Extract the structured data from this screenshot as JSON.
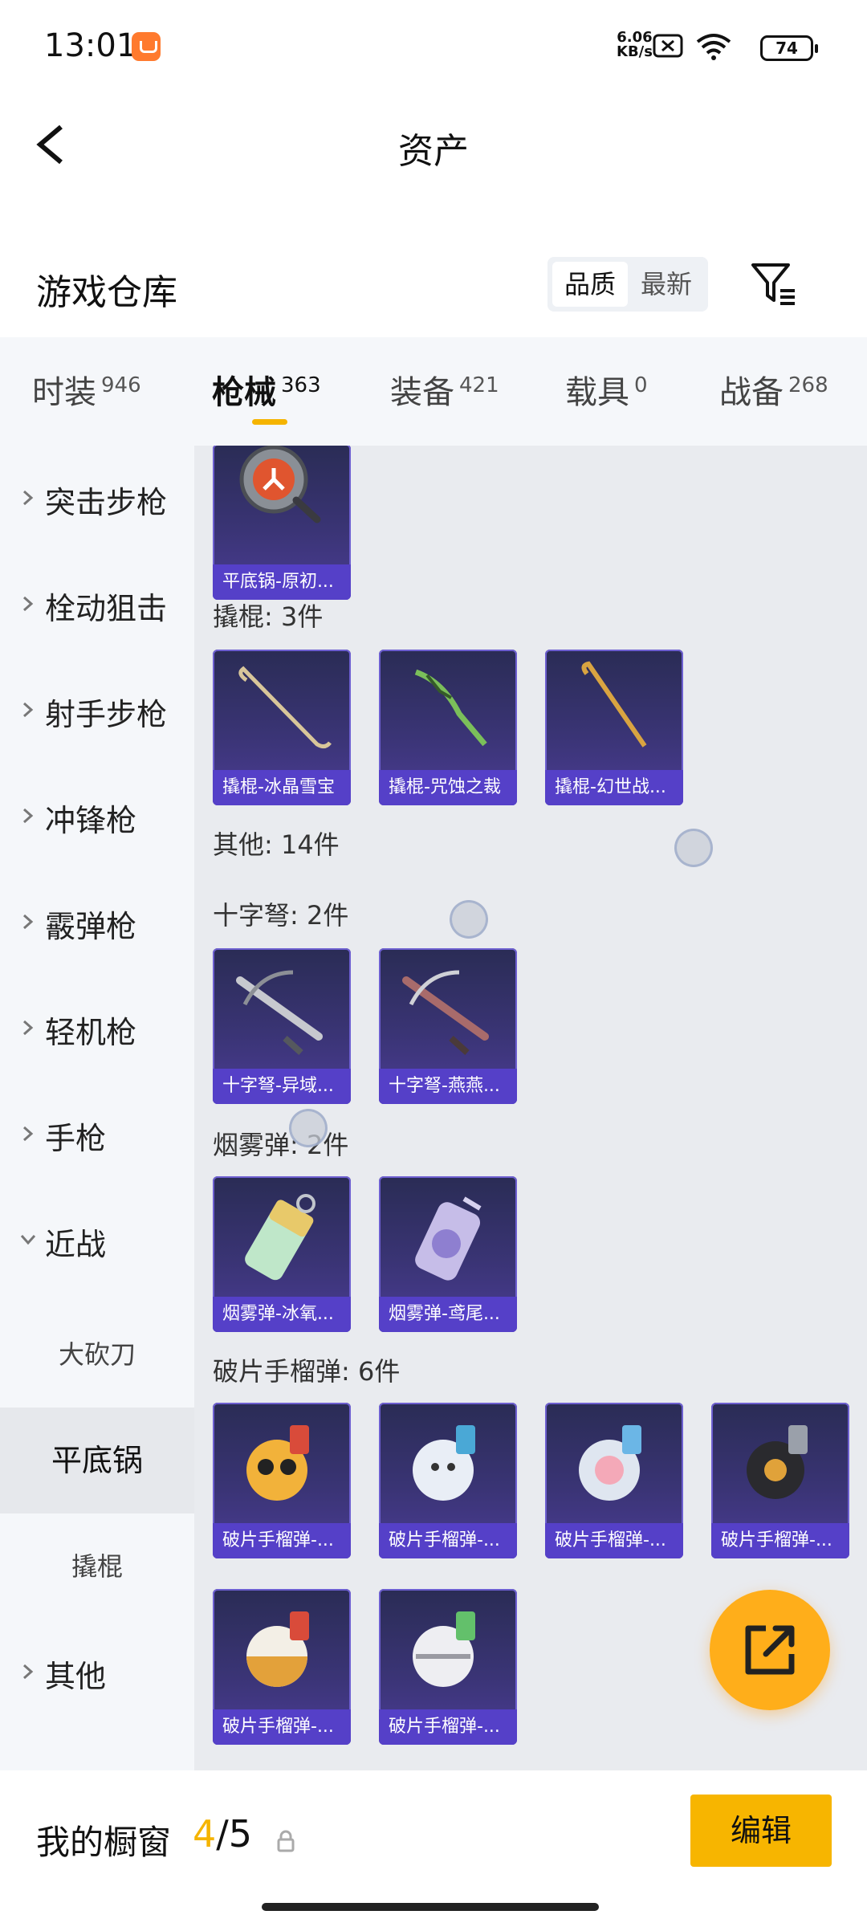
{
  "status_bar": {
    "time": "13:01",
    "net_speed_value": "6.06",
    "net_speed_unit": "KB/s",
    "battery": "74",
    "icons": [
      "app-notification-icon",
      "sim-disabled-icon",
      "wifi-icon",
      "battery-icon"
    ]
  },
  "header": {
    "title": "资产",
    "back_icon": "chevron-left-icon"
  },
  "warehouse": {
    "title": "游戏仓库",
    "sort_options": [
      "品质",
      "最新"
    ],
    "sort_selected": "品质",
    "filter_icon": "filter-icon"
  },
  "tabs": [
    {
      "label": "时装",
      "count": "946"
    },
    {
      "label": "枪械",
      "count": "363",
      "active": true
    },
    {
      "label": "装备",
      "count": "421"
    },
    {
      "label": "载具",
      "count": "0"
    },
    {
      "label": "战备",
      "count": "268"
    }
  ],
  "sidebar": {
    "categories": [
      {
        "label": "突击步枪",
        "expanded": false
      },
      {
        "label": "栓动狙击",
        "expanded": false
      },
      {
        "label": "射手步枪",
        "expanded": false
      },
      {
        "label": "冲锋枪",
        "expanded": false
      },
      {
        "label": "霰弹枪",
        "expanded": false
      },
      {
        "label": "轻机枪",
        "expanded": false
      },
      {
        "label": "手枪",
        "expanded": false
      },
      {
        "label": "近战",
        "expanded": true
      },
      {
        "label": "其他",
        "expanded": false
      }
    ],
    "subitems": [
      {
        "label": "大砍刀"
      },
      {
        "label": "平底锅",
        "selected": true
      },
      {
        "label": "撬棍"
      }
    ]
  },
  "content": {
    "groups": [
      {
        "title": "",
        "items": [
          {
            "caption": "平底锅-原初..."
          }
        ]
      },
      {
        "title": "撬棍: 3件",
        "items": [
          {
            "caption": "撬棍-冰晶雪宝"
          },
          {
            "caption": "撬棍-咒蚀之裁"
          },
          {
            "caption": "撬棍-幻世战..."
          }
        ]
      },
      {
        "title": "其他: 14件",
        "items": []
      },
      {
        "title": "十字弩: 2件",
        "items": [
          {
            "caption": "十字弩-异域..."
          },
          {
            "caption": "十字弩-燕燕..."
          }
        ]
      },
      {
        "title": "烟雾弹: 2件",
        "items": [
          {
            "caption": "烟雾弹-冰氧..."
          },
          {
            "caption": "烟雾弹-鸢尾..."
          }
        ]
      },
      {
        "title": "破片手榴弹: 6件",
        "items": [
          {
            "caption": "破片手榴弹-..."
          },
          {
            "caption": "破片手榴弹-..."
          },
          {
            "caption": "破片手榴弹-..."
          },
          {
            "caption": "破片手榴弹-..."
          },
          {
            "caption": "破片手榴弹-..."
          },
          {
            "caption": "破片手榴弹-..."
          }
        ]
      }
    ]
  },
  "fab": {
    "icon": "share-external-icon"
  },
  "bottom_bar": {
    "label": "我的橱窗",
    "current": "4",
    "total": "/5",
    "lock_icon": "lock-icon",
    "edit_label": "编辑"
  },
  "colors": {
    "accent": "#f5b400",
    "card_bg": "#3a3475",
    "card_caption": "#5540c8",
    "fab": "#ffae1a"
  }
}
